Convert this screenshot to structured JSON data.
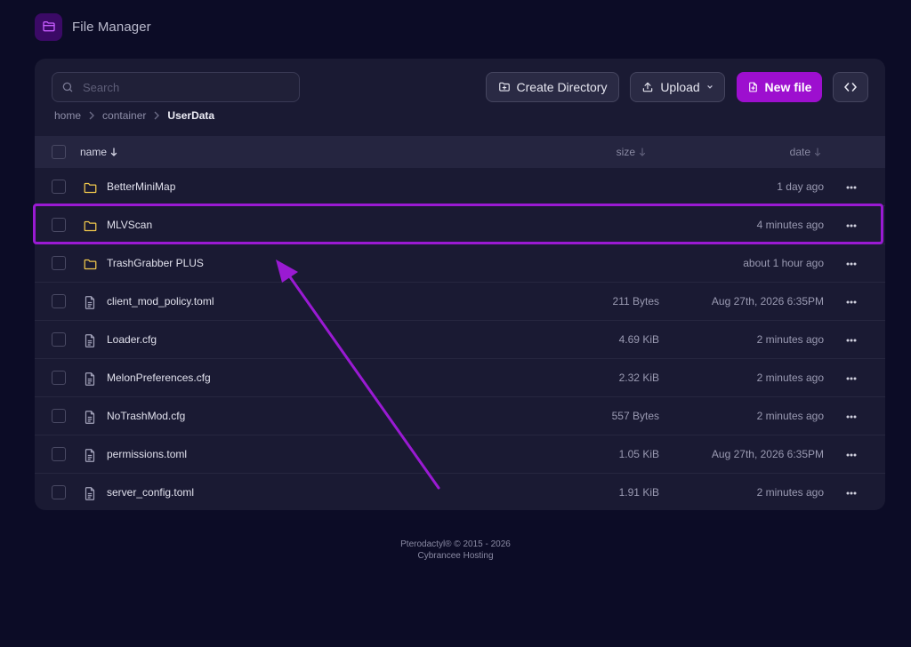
{
  "header": {
    "title": "File Manager",
    "logo_icon": "folder-icon"
  },
  "search": {
    "placeholder": "Search"
  },
  "toolbar": {
    "create_directory_label": "Create Directory",
    "upload_label": "Upload",
    "new_file_label": "New file",
    "accent_color": "#9d0fcf"
  },
  "breadcrumb": {
    "items": [
      "home",
      "container"
    ],
    "current": "UserData"
  },
  "table": {
    "columns": {
      "name": "name",
      "size": "size",
      "date": "date"
    },
    "rows": [
      {
        "name": "BetterMiniMap",
        "type": "folder",
        "size": "",
        "date": "1 day ago"
      },
      {
        "name": "MLVScan",
        "type": "folder",
        "size": "",
        "date": "4 minutes ago",
        "highlighted": true
      },
      {
        "name": "TrashGrabber PLUS",
        "type": "folder",
        "size": "",
        "date": "about 1 hour ago"
      },
      {
        "name": "client_mod_policy.toml",
        "type": "file",
        "size": "211 Bytes",
        "date": "Aug 27th, 2026 6:35PM"
      },
      {
        "name": "Loader.cfg",
        "type": "file",
        "size": "4.69 KiB",
        "date": "2 minutes ago"
      },
      {
        "name": "MelonPreferences.cfg",
        "type": "file",
        "size": "2.32 KiB",
        "date": "2 minutes ago"
      },
      {
        "name": "NoTrashMod.cfg",
        "type": "file",
        "size": "557 Bytes",
        "date": "2 minutes ago"
      },
      {
        "name": "permissions.toml",
        "type": "file",
        "size": "1.05 KiB",
        "date": "Aug 27th, 2026 6:35PM"
      },
      {
        "name": "server_config.toml",
        "type": "file",
        "size": "1.91 KiB",
        "date": "2 minutes ago"
      }
    ]
  },
  "annotation": {
    "color": "#9a1ad3"
  },
  "footer": {
    "line1": "Pterodactyl® © 2015 - 2026",
    "line2": "Cybrancee Hosting"
  }
}
